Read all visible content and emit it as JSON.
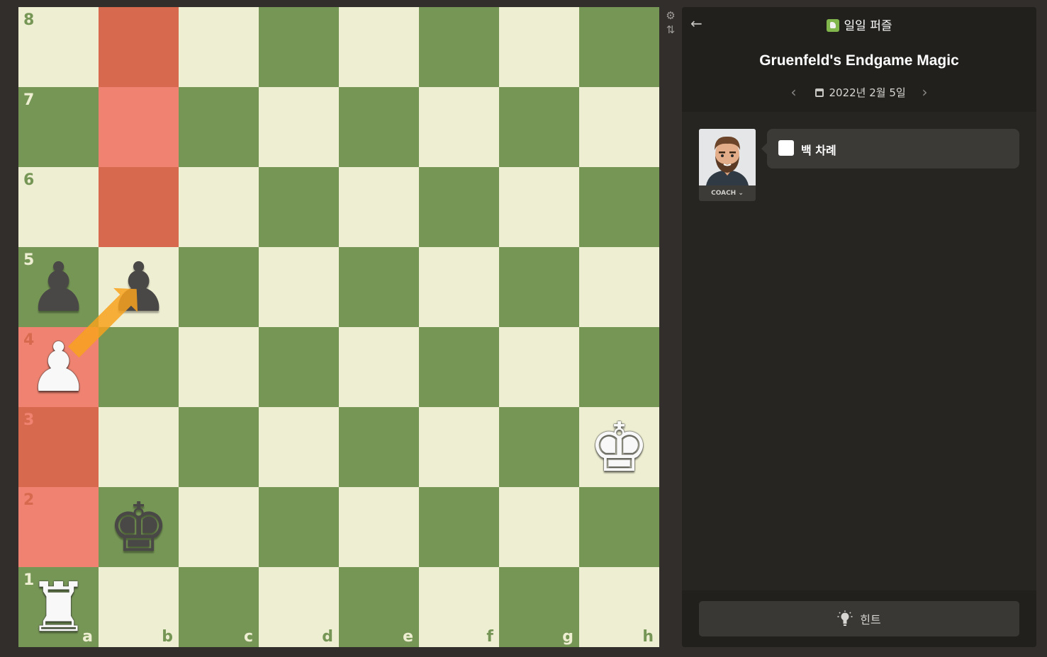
{
  "board": {
    "files": [
      "a",
      "b",
      "c",
      "d",
      "e",
      "f",
      "g",
      "h"
    ],
    "ranks": [
      "8",
      "7",
      "6",
      "5",
      "4",
      "3",
      "2",
      "1"
    ],
    "light_color": "#eeeed2",
    "dark_color": "#769656",
    "highlight_light": "#ef8270",
    "highlight_dark": "#d6694e",
    "highlighted_squares": [
      "b8",
      "b7",
      "b6",
      "a4",
      "a3",
      "a2"
    ],
    "pieces": [
      {
        "square": "a5",
        "glyph": "♟",
        "color": "b",
        "label": "black pawn"
      },
      {
        "square": "b5",
        "glyph": "♟",
        "color": "b",
        "label": "black pawn"
      },
      {
        "square": "a4",
        "glyph": "♟",
        "color": "w",
        "label": "white pawn"
      },
      {
        "square": "h3",
        "glyph": "♚",
        "color": "w",
        "label": "white king"
      },
      {
        "square": "b2",
        "glyph": "♚",
        "color": "b",
        "label": "black king"
      },
      {
        "square": "a1",
        "glyph": "♜",
        "color": "w",
        "label": "white rook"
      }
    ],
    "arrow": {
      "from": "a4",
      "to": "b5",
      "color": "#f7a21e"
    }
  },
  "tools": {
    "settings_icon": "gear-icon",
    "flip_icon": "flip-board-icon"
  },
  "panel": {
    "back_icon": "arrow-left-icon",
    "title": "일일 퍼즐",
    "puzzle_name": "Gruenfeld's Endgame Magic",
    "date": "2022년 2월 5일",
    "prev_icon": "‹",
    "next_icon": "›",
    "coach_label": "COACH ⌄",
    "turn_text": "백 차례",
    "hint_label": "힌트"
  }
}
